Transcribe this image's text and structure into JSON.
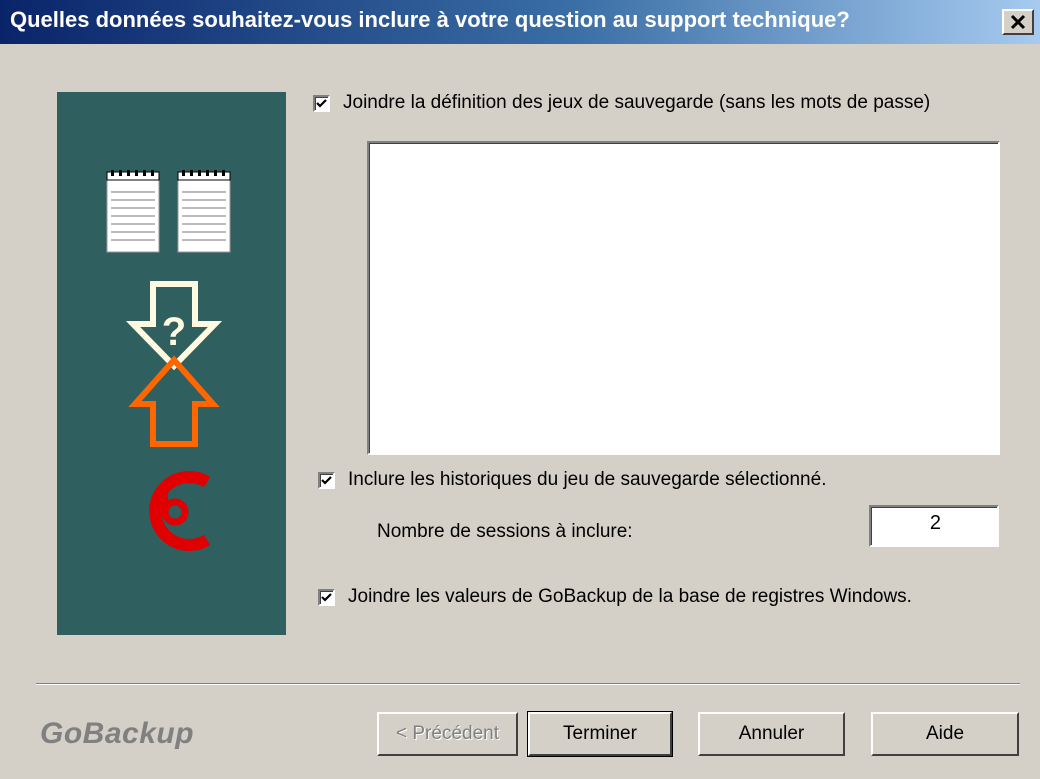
{
  "title": "Quelles données souhaitez-vous inclure à votre question au support technique?",
  "close_symbol": "✕",
  "options": {
    "definition": {
      "label": "Joindre la définition des jeux de sauvegarde (sans les mots de passe)",
      "checked": true
    },
    "history": {
      "label": "Inclure les historiques du jeu de sauvegarde sélectionné.",
      "checked": true
    },
    "sessions_label": "Nombre de sessions à inclure:",
    "sessions_value": "2",
    "registry": {
      "label": "Joindre les valeurs de GoBackup de la base de registres Windows.",
      "checked": true
    }
  },
  "brand": "GoBackup",
  "buttons": {
    "previous": "< Précédent",
    "finish": "Terminer",
    "cancel": "Annuler",
    "help": "Aide"
  },
  "colors": {
    "sidebar": "#2f5f5f",
    "arrow_orange": "#ff6600",
    "logo_red": "#e00000"
  },
  "icons": [
    "notepad-icon",
    "notepad-icon",
    "question-arrow-down-icon",
    "arrow-up-icon",
    "gobackup-logo-icon"
  ]
}
